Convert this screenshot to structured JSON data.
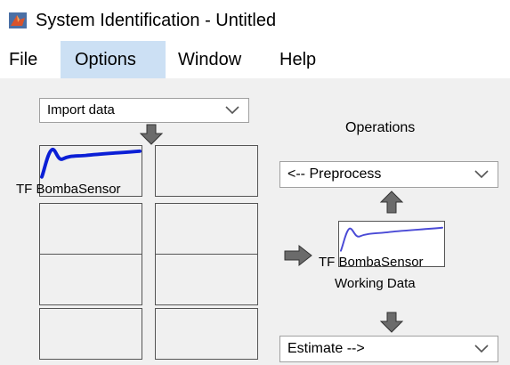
{
  "window": {
    "title": "System Identification - Untitled",
    "icon": "matlab-icon"
  },
  "menu": {
    "items": [
      {
        "label": "File",
        "active": false
      },
      {
        "label": "Options",
        "active": true
      },
      {
        "label": "Window",
        "active": false
      },
      {
        "label": "Help",
        "active": false
      }
    ]
  },
  "data_board": {
    "import_select": "Import data",
    "selected_dataset": "TF BombaSensor",
    "selected_dataset_color": "#0b1fd6",
    "slots_total": 8
  },
  "operations": {
    "title": "Operations",
    "preprocess_select": "<-- Preprocess",
    "working_data": {
      "name": "TF BombaSensor",
      "caption": "Working Data",
      "line_color": "#4a4ad6"
    },
    "estimate_select": "Estimate -->"
  },
  "colors": {
    "active_menu": "#cce0f4",
    "panel_bg": "#f0f0f0",
    "arrow_gray": "#6b6b6b",
    "icon_orange": "#d9532c"
  }
}
